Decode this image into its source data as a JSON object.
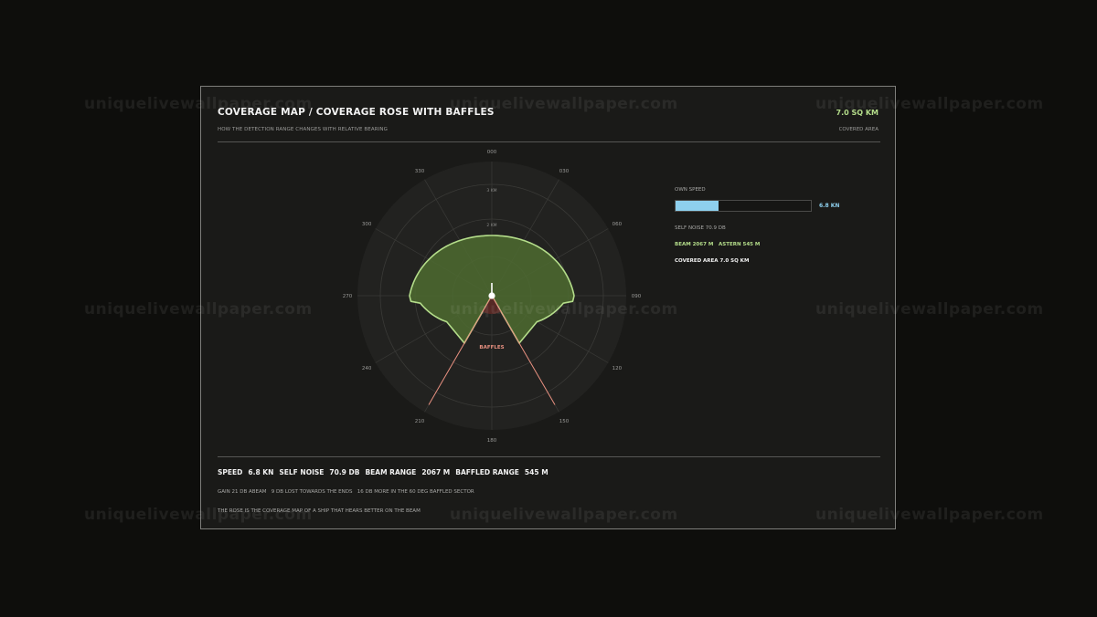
{
  "header": {
    "title": "COVERAGE MAP / COVERAGE ROSE WITH BAFFLES",
    "subtitle": "HOW THE DETECTION RANGE CHANGES WITH RELATIVE BEARING",
    "area_value": "7.0 SQ KM",
    "area_label": "COVERED AREA"
  },
  "rose": {
    "bearing_labels": [
      "000",
      "030",
      "060",
      "090",
      "120",
      "150",
      "180",
      "210",
      "240",
      "270",
      "300",
      "330"
    ],
    "ring_labels": [
      "2 KM",
      "3 KM"
    ],
    "baffles_label": "BAFFLES",
    "colors": {
      "coverage_fill": "#4d6b30",
      "coverage_stroke": "#b4dd8a",
      "baffles_fill": "#5a2a26",
      "baffles_stroke": "#e89080",
      "grid": "#3a3a37"
    }
  },
  "info": {
    "speed_label": "OWN SPEED",
    "speed_fraction": 0.32,
    "speed_value": "6.8 KN",
    "self_noise_line": "SELF NOISE 70.9 DB",
    "range_line": "BEAM 2067 M   ASTERN 545 M",
    "area_line": "COVERED AREA 7.0 SQ KM",
    "bar_color": "#8ed0ee"
  },
  "stats": {
    "speed_label": "SPEED",
    "speed_value": "6.8 KN",
    "noise_label": "SELF NOISE",
    "noise_value": "70.9 DB",
    "beam_label": "BEAM RANGE",
    "beam_value": "2067 M",
    "baffled_label": "BAFFLED RANGE",
    "baffled_value": "545 M"
  },
  "notes": {
    "gain_line": "GAIN 21 DB ABEAM   9 DB LOST TOWARDS THE ENDS   16 DB MORE IN THE 60 DEG BAFFLED SECTOR",
    "rose_line": "THE ROSE IS THE COVERAGE MAP OF A SHIP THAT HEARS BETTER ON THE BEAM"
  },
  "watermark": "uniquelivewallpaper.com"
}
